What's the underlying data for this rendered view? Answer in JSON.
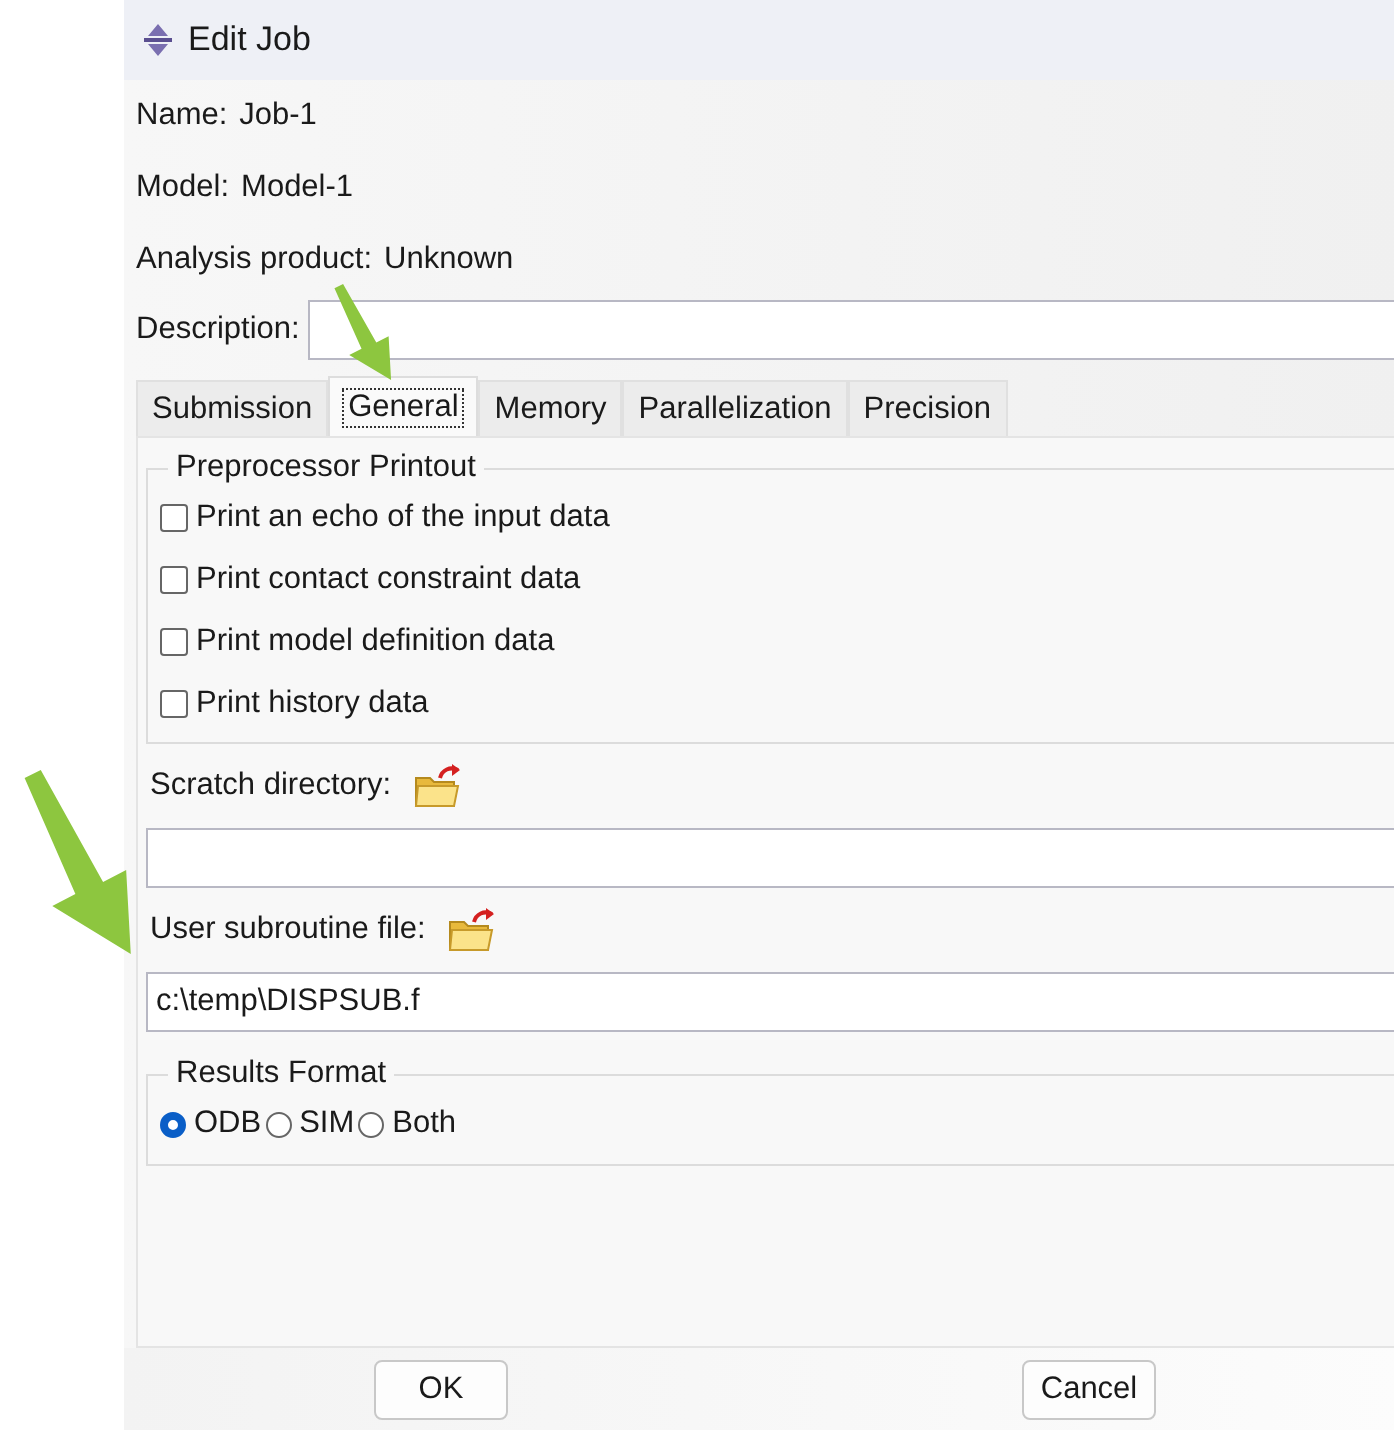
{
  "window": {
    "title": "Edit Job"
  },
  "info": [
    {
      "label": "Name:",
      "value": "Job-1"
    },
    {
      "label": "Model:",
      "value": "Model-1"
    },
    {
      "label": "Analysis product:",
      "value": "Unknown"
    }
  ],
  "description": {
    "label": "Description:"
  },
  "tabs": [
    {
      "label": "Submission",
      "selected": false
    },
    {
      "label": "General",
      "selected": true
    },
    {
      "label": "Memory",
      "selected": false
    },
    {
      "label": "Parallelization",
      "selected": false
    },
    {
      "label": "Precision",
      "selected": false
    }
  ],
  "preprocessor_printout": {
    "title": "Preprocessor Printout",
    "options": [
      {
        "label": "Print an echo of the input data",
        "checked": false
      },
      {
        "label": "Print contact constraint data",
        "checked": false
      },
      {
        "label": "Print model definition data",
        "checked": false
      },
      {
        "label": "Print history data",
        "checked": false
      }
    ]
  },
  "scratch_directory": {
    "label": "Scratch directory:"
  },
  "user_subroutine_file": {
    "label": "User subroutine file:",
    "value": "c:\\temp\\DISPSUB.f"
  },
  "results_format": {
    "title": "Results Format",
    "options": [
      {
        "label": "ODB",
        "selected": true
      },
      {
        "label": "SIM",
        "selected": false
      },
      {
        "label": "Both",
        "selected": false
      }
    ]
  },
  "buttons": [
    "OK",
    "Cancel"
  ]
}
